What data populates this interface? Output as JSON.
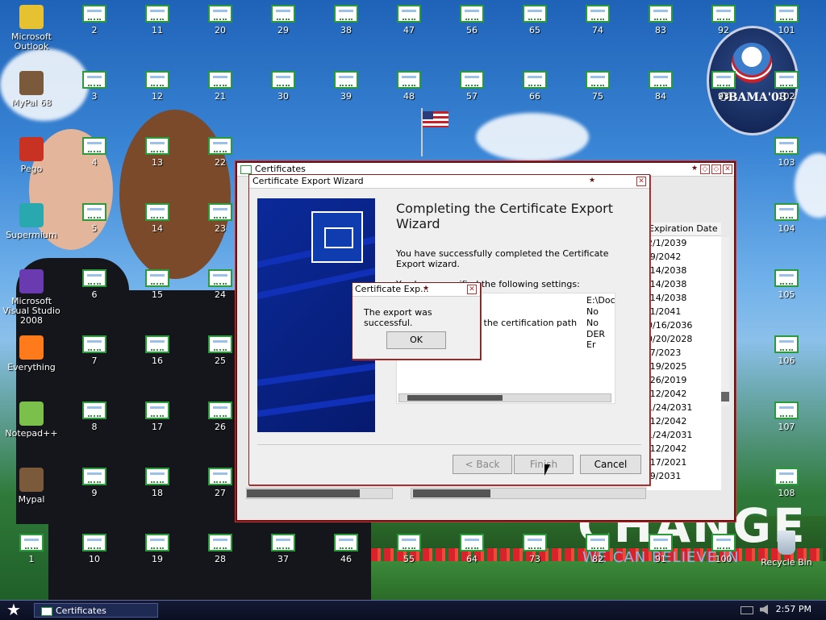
{
  "desktop": {
    "left_icons": [
      {
        "label": "Microsoft Outlook",
        "color": "#e6c232"
      },
      {
        "label": "MyPal 68",
        "color": "#7a5a3a"
      },
      {
        "label": "Pego",
        "color": "#c83222"
      },
      {
        "label": "Supermium",
        "color": "#2aa8b0"
      },
      {
        "label": "Microsoft Visual Studio 2008",
        "color": "#6a3ab0"
      },
      {
        "label": "Everything",
        "color": "#ff7a1a"
      },
      {
        "label": "Notepad++",
        "color": "#7ac04a"
      },
      {
        "label": "Mypal",
        "color": "#7a5a3a"
      }
    ],
    "cert_icons": [
      "1",
      "2",
      "3",
      "4",
      "5",
      "6",
      "7",
      "8",
      "9",
      "10",
      "11",
      "12",
      "13",
      "14",
      "15",
      "16",
      "17",
      "18",
      "19",
      "20",
      "21",
      "22",
      "23",
      "24",
      "25",
      "26",
      "27",
      "28",
      "29",
      "30",
      "37",
      "38",
      "39",
      "46",
      "47",
      "48",
      "55",
      "56",
      "57",
      "64",
      "65",
      "66",
      "73",
      "74",
      "75",
      "82",
      "83",
      "84",
      "91",
      "92",
      "93",
      "100",
      "101",
      "102",
      "103",
      "104",
      "105",
      "106",
      "107",
      "108"
    ],
    "recycle_bin": "Recycle Bin",
    "badge": "OBAMA'08",
    "slogan_big": "CHANGE",
    "slogan_small": "WE CAN BELIEVE IN"
  },
  "main_window": {
    "title": "Certificates",
    "column_header": "Expiration Date",
    "expiration_dates": [
      "2/1/2039",
      "/9/2042",
      "/14/2038",
      "/14/2038",
      "/14/2038",
      "/1/2041",
      "0/16/2036",
      "0/20/2028",
      "/7/2023",
      "/19/2025",
      "/26/2019",
      "/12/2042",
      "1/24/2031",
      "/12/2042",
      "1/24/2031",
      "/12/2042",
      "/17/2021",
      "/9/2031"
    ]
  },
  "wizard": {
    "title": "Certificate Export Wizard",
    "heading": "Completing the Certificate Export Wizard",
    "paragraph": "You have successfully completed the Certificate Export wizard.",
    "settings_label": "You have specified the following settings:",
    "settings_rows": [
      {
        "name": "",
        "value": "E:\\Doc"
      },
      {
        "name": "",
        "value": "No"
      },
      {
        "name": "es in the certification path",
        "value": "No"
      },
      {
        "name": "",
        "value": "DER Er"
      }
    ],
    "back": "< Back",
    "finish": "Finish",
    "cancel": "Cancel"
  },
  "message_box": {
    "title": "Certificate Exp...",
    "text": "The export was successful.",
    "ok": "OK"
  },
  "taskbar": {
    "task": "Certificates",
    "clock": "2:57 PM"
  }
}
